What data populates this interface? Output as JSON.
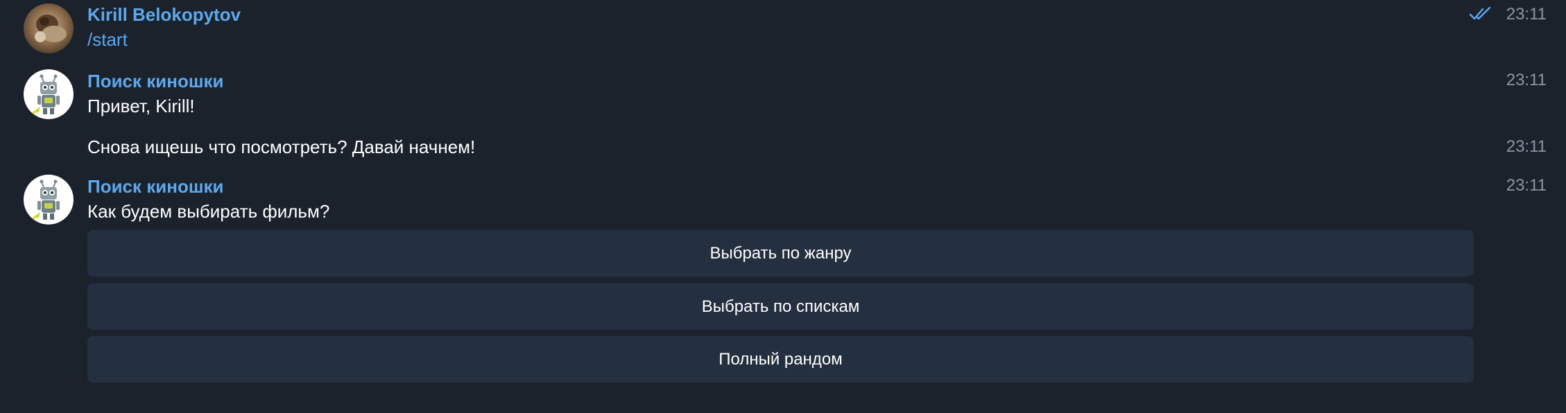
{
  "messages": [
    {
      "sender": "Kirill Belokopytov",
      "text": "/start",
      "time": "23:11",
      "read_status": "double-check-icon"
    },
    {
      "sender": "Поиск киношки",
      "text": "Привет, Kirill!",
      "time": "23:11"
    },
    {
      "text": "Снова ищешь что посмотреть? Давай начнем!",
      "time": "23:11"
    },
    {
      "sender": "Поиск киношки",
      "text": "Как будем выбирать фильм?",
      "time": "23:11"
    }
  ],
  "keyboard": {
    "buttons": [
      "Выбрать по жанру",
      "Выбрать по спискам",
      "Полный рандом"
    ]
  },
  "colors": {
    "background": "#1b222c",
    "sender_name": "#5ea8ec",
    "button_bg": "#242f3f",
    "timestamp": "#8c96a3"
  }
}
